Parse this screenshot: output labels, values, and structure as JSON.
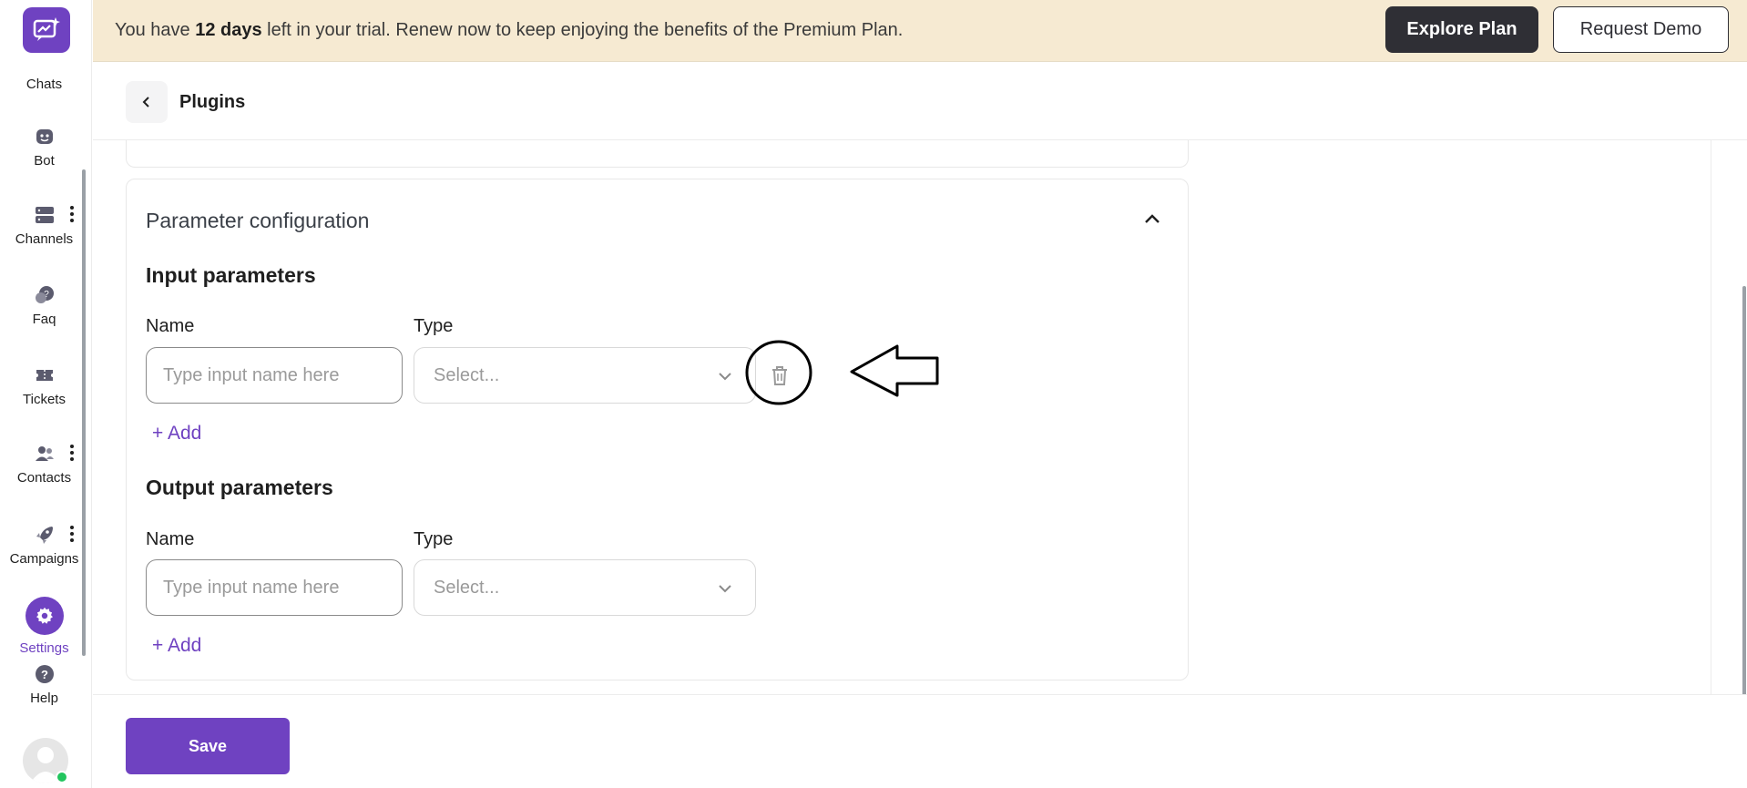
{
  "banner": {
    "text_before": "You have ",
    "text_bold": "12 days",
    "text_after": " left in your trial. Renew now to keep enjoying the benefits of the Premium Plan.",
    "explore_label": "Explore Plan",
    "demo_label": "Request Demo"
  },
  "sidebar": {
    "items": [
      {
        "label": "Chats",
        "icon": "chats-icon"
      },
      {
        "label": "Bot",
        "icon": "bot-icon"
      },
      {
        "label": "Channels",
        "icon": "channels-icon"
      },
      {
        "label": "Faq",
        "icon": "faq-icon"
      },
      {
        "label": "Tickets",
        "icon": "tickets-icon"
      },
      {
        "label": "Contacts",
        "icon": "contacts-icon"
      },
      {
        "label": "Campaigns",
        "icon": "campaigns-icon"
      },
      {
        "label": "Settings",
        "icon": "gear-icon"
      },
      {
        "label": "Help",
        "icon": "help-icon"
      }
    ],
    "active": "Settings"
  },
  "header": {
    "title": "Plugins"
  },
  "config": {
    "title": "Parameter configuration",
    "input": {
      "title": "Input parameters",
      "name_label": "Name",
      "type_label": "Type",
      "name_placeholder": "Type input name here",
      "type_placeholder": "Select...",
      "add_label": "+ Add"
    },
    "output": {
      "title": "Output parameters",
      "name_label": "Name",
      "type_label": "Type",
      "name_placeholder": "Type input name here",
      "type_placeholder": "Select...",
      "add_label": "+ Add"
    }
  },
  "footer": {
    "save_label": "Save"
  },
  "colors": {
    "accent": "#6f42c1",
    "banner_bg": "#f6ead2",
    "dark_button": "#2f2f35"
  }
}
